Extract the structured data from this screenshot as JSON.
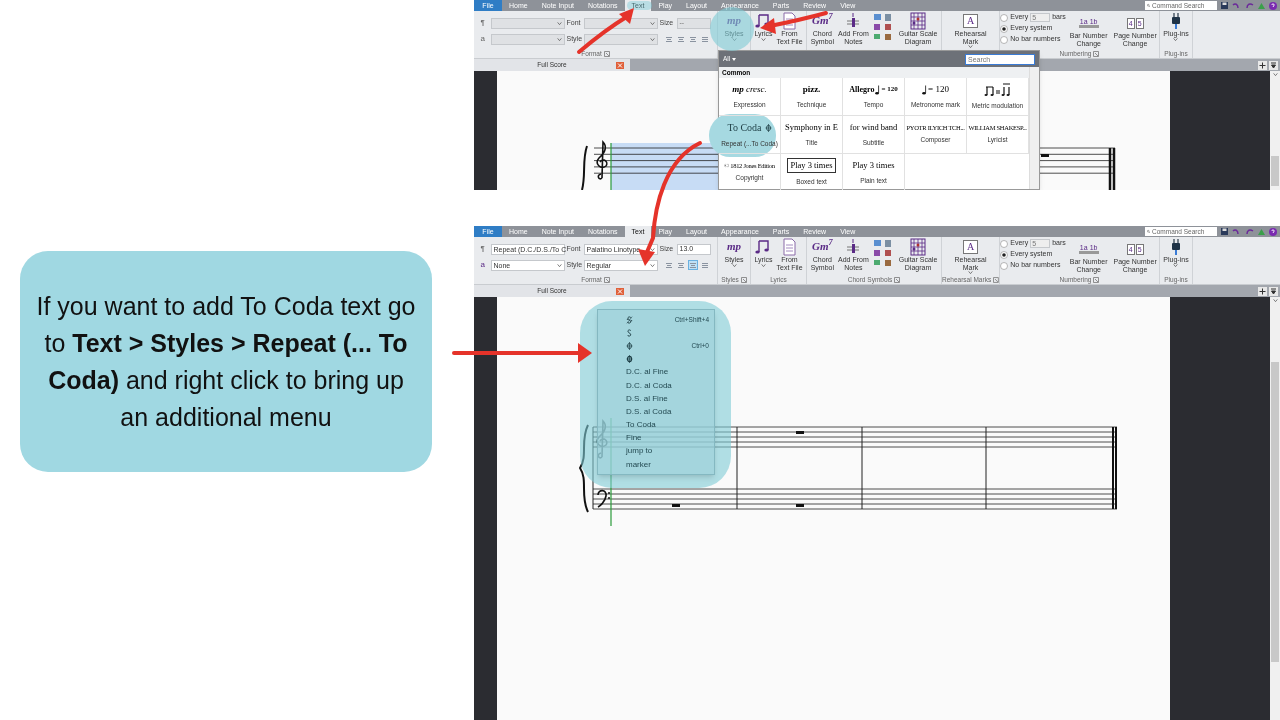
{
  "callout": {
    "text": "If you want to add To Coda text go to **Text > Styles > Repeat (... To Coda)** and right click to bring up an additional menu"
  },
  "screenshots": [
    {
      "tabs": [
        {
          "label": "File",
          "kind": "file",
          "selected": false
        },
        {
          "label": "Home",
          "kind": "tab",
          "selected": false
        },
        {
          "label": "Note Input",
          "kind": "tab",
          "selected": false
        },
        {
          "label": "Notations",
          "kind": "tab",
          "selected": false
        },
        {
          "label": "Text",
          "kind": "tab",
          "selected": true
        },
        {
          "label": "Play",
          "kind": "tab",
          "selected": false
        },
        {
          "label": "Layout",
          "kind": "tab",
          "selected": false
        },
        {
          "label": "Appearance",
          "kind": "tab",
          "selected": false
        },
        {
          "label": "Parts",
          "kind": "tab",
          "selected": false
        },
        {
          "label": "Review",
          "kind": "tab",
          "selected": false
        },
        {
          "label": "View",
          "kind": "tab",
          "selected": false
        }
      ],
      "command_search": {
        "placeholder": "Command Search"
      },
      "format": {
        "disabled": true,
        "paragraph_icon": "¶",
        "character_icon": "a",
        "font_label": "Font",
        "size_label": "Size",
        "style_label": "Style",
        "size": "--",
        "alignment": [
          {
            "selected": false
          },
          {
            "selected": false
          },
          {
            "selected": false
          },
          {
            "selected": false
          }
        ]
      },
      "groups": [
        {
          "kind": "format",
          "label": "Format",
          "launcher": true
        },
        {
          "kind": "buttons",
          "buttons": [
            {
              "kind": "glyph",
              "glyph": "mp",
              "label": "Styles",
              "menu": true
            }
          ]
        },
        {
          "kind": "buttons",
          "buttons": [
            {
              "kind": "lyrics",
              "label": "Lyrics",
              "menu": true
            },
            {
              "kind": "document",
              "label": "From\nText File"
            }
          ]
        },
        {
          "kind": "buttons",
          "buttons": [
            {
              "kind": "glyph",
              "glyph": "Gm$^{7}$",
              "label": "Chord\nSymbol"
            },
            {
              "kind": "notes",
              "label": "Add From\nNotes"
            },
            {
              "kind": "tools"
            },
            {
              "kind": "guitar",
              "label": "Guitar Scale\nDiagram"
            }
          ]
        },
        {
          "kind": "buttons",
          "buttons": [
            {
              "kind": "boxed",
              "glyph": "A",
              "label": "Rehearsal\nMark",
              "menu": true
            }
          ]
        },
        {
          "kind": "numbering",
          "label": "Numbering",
          "launcher": true,
          "radios": [
            {
              "label": "Every",
              "value": "5",
              "unit": "bars",
              "selected": false
            },
            {
              "label": "Every system",
              "selected": true
            },
            {
              "label": "No bar numbers",
              "selected": false
            }
          ],
          "buttons": [
            {
              "kind": "bar-number",
              "glyphs": [
                "1a",
                "1b"
              ],
              "label": "Bar Number\nChange"
            },
            {
              "kind": "pages",
              "glyphs": [
                "4",
                "5"
              ],
              "label": "Page Number\nChange"
            }
          ]
        },
        {
          "kind": "buttons",
          "label": "Plug-ins",
          "buttons": [
            {
              "kind": "plug",
              "label": "Plug-ins",
              "menu": true
            }
          ]
        }
      ],
      "document_tab": "Full Score",
      "score": {
        "first_bar_selected": true
      },
      "styles_panel": {
        "filter": "All",
        "search_placeholder": "Search",
        "section": "Common",
        "cells": [
          {
            "kind": "expression",
            "sample": "**mp** cresc.",
            "label": "Expression"
          },
          {
            "kind": "technique",
            "sample": "pizz.",
            "label": "Technique"
          },
          {
            "kind": "tempo",
            "sample": "Allegro",
            "suffix": "= 120",
            "label": "Tempo"
          },
          {
            "kind": "metronome",
            "suffix": "= 120",
            "label": "Metronome mark"
          },
          {
            "kind": "metric",
            "label": "Metric modulation"
          },
          {
            "kind": "repeat",
            "sample": "To Coda",
            "label": "Repeat (...To Coda)"
          },
          {
            "kind": "plain",
            "sample": "Symphony in E",
            "label": "Title"
          },
          {
            "kind": "plain",
            "sample": "for wind band",
            "label": "Subtitle"
          },
          {
            "kind": "small",
            "sample": "PYOTR ILYICH TCH...",
            "label": "Composer"
          },
          {
            "kind": "small",
            "sample": "WILLIAM SHAKESP...",
            "label": "Lyricist"
          },
          {
            "kind": "small",
            "sample": "© 1812 Jones Edition",
            "label": "Copyright"
          },
          {
            "kind": "boxed",
            "sample": "Play 3 times",
            "label": "Boxed text"
          },
          {
            "kind": "plain",
            "sample": "Play 3 times",
            "label": "Plain text"
          }
        ]
      }
    },
    {
      "tabs": [
        {
          "label": "File",
          "kind": "file",
          "selected": false
        },
        {
          "label": "Home",
          "kind": "tab",
          "selected": false
        },
        {
          "label": "Note Input",
          "kind": "tab",
          "selected": false
        },
        {
          "label": "Notations",
          "kind": "tab",
          "selected": false
        },
        {
          "label": "Text",
          "kind": "tab",
          "selected": true
        },
        {
          "label": "Play",
          "kind": "tab",
          "selected": false
        },
        {
          "label": "Layout",
          "kind": "tab",
          "selected": false
        },
        {
          "label": "Appearance",
          "kind": "tab",
          "selected": false
        },
        {
          "label": "Parts",
          "kind": "tab",
          "selected": false
        },
        {
          "label": "Review",
          "kind": "tab",
          "selected": false
        },
        {
          "label": "View",
          "kind": "tab",
          "selected": false
        }
      ],
      "command_search": {
        "placeholder": "Command Search"
      },
      "format": {
        "disabled": false,
        "paragraph_icon": "¶",
        "character_icon": "a",
        "paragraph_style": "Repeat (D.C./D.S./To C",
        "font_label": "Font",
        "font": "Palatino Linotype",
        "size_label": "Size",
        "size": "13.0",
        "character_style": "None",
        "style_label": "Style",
        "style": "Regular",
        "alignment": [
          {
            "selected": false
          },
          {
            "selected": false
          },
          {
            "selected": true
          },
          {
            "selected": false
          }
        ]
      },
      "groups": [
        {
          "kind": "format",
          "label": "Format",
          "launcher": true
        },
        {
          "kind": "buttons",
          "label": "Styles",
          "launcher": true,
          "buttons": [
            {
              "kind": "glyph",
              "glyph": "mp",
              "label": "Styles",
              "menu": true
            }
          ]
        },
        {
          "kind": "buttons",
          "label": "Lyrics",
          "buttons": [
            {
              "kind": "lyrics",
              "label": "Lyrics",
              "menu": true
            },
            {
              "kind": "document",
              "label": "From\nText File"
            }
          ]
        },
        {
          "kind": "buttons",
          "label": "Chord Symbols",
          "launcher": true,
          "buttons": [
            {
              "kind": "glyph",
              "glyph": "Gm$^{7}$",
              "label": "Chord\nSymbol"
            },
            {
              "kind": "notes",
              "label": "Add From\nNotes"
            },
            {
              "kind": "tools"
            },
            {
              "kind": "guitar",
              "label": "Guitar Scale\nDiagram"
            }
          ]
        },
        {
          "kind": "buttons",
          "label": "Rehearsal Marks",
          "launcher": true,
          "buttons": [
            {
              "kind": "boxed",
              "glyph": "A",
              "label": "Rehearsal\nMark",
              "menu": true
            }
          ]
        },
        {
          "kind": "numbering",
          "label": "Numbering",
          "launcher": true,
          "radios": [
            {
              "label": "Every",
              "value": "5",
              "unit": "bars",
              "selected": false
            },
            {
              "label": "Every system",
              "selected": true
            },
            {
              "label": "No bar numbers",
              "selected": false
            }
          ],
          "buttons": [
            {
              "kind": "bar-number",
              "glyphs": [
                "1a",
                "1b"
              ],
              "label": "Bar Number\nChange"
            },
            {
              "kind": "pages",
              "glyphs": [
                "4",
                "5"
              ],
              "label": "Page Number\nChange"
            }
          ]
        },
        {
          "kind": "buttons",
          "label": "Plug-ins",
          "buttons": [
            {
              "kind": "plug",
              "label": "Plug-ins",
              "menu": true
            }
          ]
        }
      ],
      "document_tab": "Full Score",
      "context_menu": {
        "items": [
          {
            "kind": "segno",
            "shortcut": "Ctrl+Shift+4"
          },
          {
            "kind": "segno-alt"
          },
          {
            "kind": "coda",
            "shortcut": "Ctrl+0"
          },
          {
            "kind": "coda-alt"
          },
          {
            "kind": "text",
            "label": "D.C. al Fine"
          },
          {
            "kind": "text",
            "label": "D.C. al Coda"
          },
          {
            "kind": "text",
            "label": "D.S. al Fine"
          },
          {
            "kind": "text",
            "label": "D.S. al Coda"
          },
          {
            "kind": "text",
            "label": "To Coda"
          },
          {
            "kind": "text",
            "label": "Fine"
          },
          {
            "kind": "text",
            "label": "jump to"
          },
          {
            "kind": "text",
            "label": "marker"
          }
        ]
      }
    }
  ]
}
